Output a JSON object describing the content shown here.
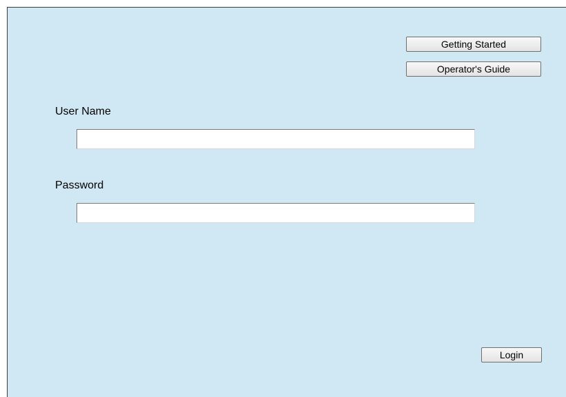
{
  "header": {
    "getting_started_label": "Getting Started",
    "operators_guide_label": "Operator's Guide"
  },
  "form": {
    "username_label": "User Name",
    "username_value": "",
    "password_label": "Password",
    "password_value": ""
  },
  "footer": {
    "login_label": "Login"
  },
  "colors": {
    "background": "#d0e8f4",
    "button_border": "#6e6e6e"
  }
}
